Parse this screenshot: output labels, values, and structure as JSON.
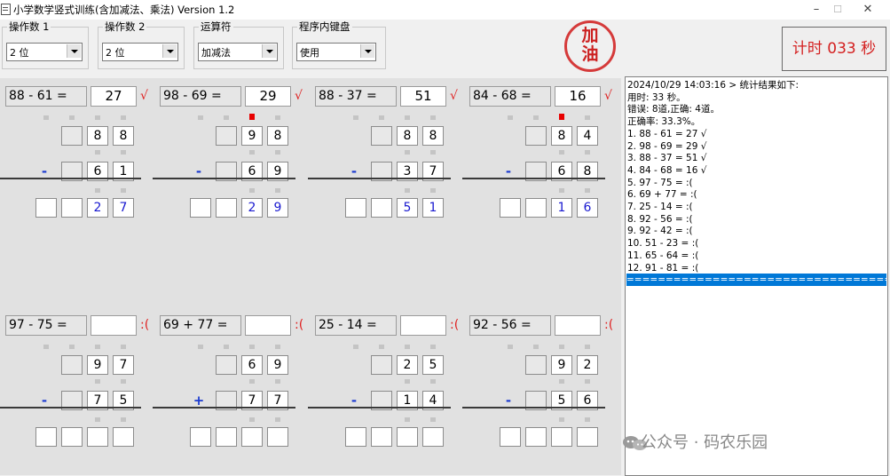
{
  "window": {
    "title": "小学数学竖式训练(含加减法、乘法) Version 1.2",
    "minimize": "–",
    "maximize": "☐",
    "close": "✕"
  },
  "toolbar": {
    "operand1": {
      "label": "操作数 1",
      "value": "2 位"
    },
    "operand2": {
      "label": "操作数 2",
      "value": "2 位"
    },
    "operator": {
      "label": "运算符",
      "value": "加减法"
    },
    "keyboard": {
      "label": "程序内键盘",
      "value": "使用"
    }
  },
  "stamp": {
    "top": "加",
    "bottom": "油",
    "color": "#cc2020"
  },
  "timer": {
    "text": "计时 033 秒",
    "color": "#d42020"
  },
  "problems": [
    {
      "expr": "88 - 61 =",
      "answer": "27",
      "mark": "√",
      "op": "-",
      "top": [
        "",
        "",
        "8",
        "8"
      ],
      "bottom": [
        "",
        "",
        "6",
        "1"
      ],
      "result": [
        "",
        "",
        "2",
        "7"
      ],
      "carry": [
        false,
        false,
        false,
        false
      ]
    },
    {
      "expr": "98 - 69 =",
      "answer": "29",
      "mark": "√",
      "op": "-",
      "top": [
        "",
        "",
        "9",
        "8"
      ],
      "bottom": [
        "",
        "",
        "6",
        "9"
      ],
      "result": [
        "",
        "",
        "2",
        "9"
      ],
      "carry": [
        false,
        false,
        true,
        false
      ]
    },
    {
      "expr": "88 - 37 =",
      "answer": "51",
      "mark": "√",
      "op": "-",
      "top": [
        "",
        "",
        "8",
        "8"
      ],
      "bottom": [
        "",
        "",
        "3",
        "7"
      ],
      "result": [
        "",
        "",
        "5",
        "1"
      ],
      "carry": [
        false,
        false,
        false,
        false
      ]
    },
    {
      "expr": "84 - 68 =",
      "answer": "16",
      "mark": "√",
      "op": "-",
      "top": [
        "",
        "",
        "8",
        "4"
      ],
      "bottom": [
        "",
        "",
        "6",
        "8"
      ],
      "result": [
        "",
        "",
        "1",
        "6"
      ],
      "carry": [
        false,
        false,
        true,
        false
      ]
    },
    {
      "expr": "97 - 75 =",
      "answer": "",
      "mark": ":(",
      "op": "-",
      "top": [
        "",
        "",
        "9",
        "7"
      ],
      "bottom": [
        "",
        "",
        "7",
        "5"
      ],
      "result": [
        "",
        "",
        "",
        ""
      ],
      "carry": [
        false,
        false,
        false,
        false
      ]
    },
    {
      "expr": "69 + 77 =",
      "answer": "",
      "mark": ":(",
      "op": "+",
      "top": [
        "",
        "",
        "6",
        "9"
      ],
      "bottom": [
        "",
        "",
        "7",
        "7"
      ],
      "result": [
        "",
        "",
        "",
        ""
      ],
      "carry": [
        false,
        false,
        false,
        false
      ]
    },
    {
      "expr": "25 - 14 =",
      "answer": "",
      "mark": ":(",
      "op": "-",
      "top": [
        "",
        "",
        "2",
        "5"
      ],
      "bottom": [
        "",
        "",
        "1",
        "4"
      ],
      "result": [
        "",
        "",
        "",
        ""
      ],
      "carry": [
        false,
        false,
        false,
        false
      ]
    },
    {
      "expr": "92 - 56 =",
      "answer": "",
      "mark": ":(",
      "op": "-",
      "top": [
        "",
        "",
        "9",
        "2"
      ],
      "bottom": [
        "",
        "",
        "5",
        "6"
      ],
      "result": [
        "",
        "",
        "",
        ""
      ],
      "carry": [
        false,
        false,
        false,
        false
      ]
    }
  ],
  "log": {
    "lines": [
      "2024/10/29 14:03:16 > 统计结果如下:",
      "用时: 33 秒。",
      "错误: 8道,正确: 4道。",
      "正确率: 33.3%。",
      "1. 88 - 61 = 27 √",
      "2. 98 - 69 = 29 √",
      "3. 88 - 37 = 51 √",
      "4. 84 - 68 = 16 √",
      "5. 97 - 75 =  :(",
      "6. 69 + 77 =  :(",
      "7. 25 - 14 =  :(",
      "8. 92 - 56 =  :(",
      "9. 92 - 42 =  :(",
      "10. 51 - 23 =  :(",
      "11. 65 - 64 =  :(",
      "12. 91 - 81 =  :("
    ],
    "selected_line": "=========================================",
    "selection_color": "#0078d7"
  },
  "watermark": {
    "text": "公众号 · 码农乐园",
    "icon": "wechat-icon"
  }
}
